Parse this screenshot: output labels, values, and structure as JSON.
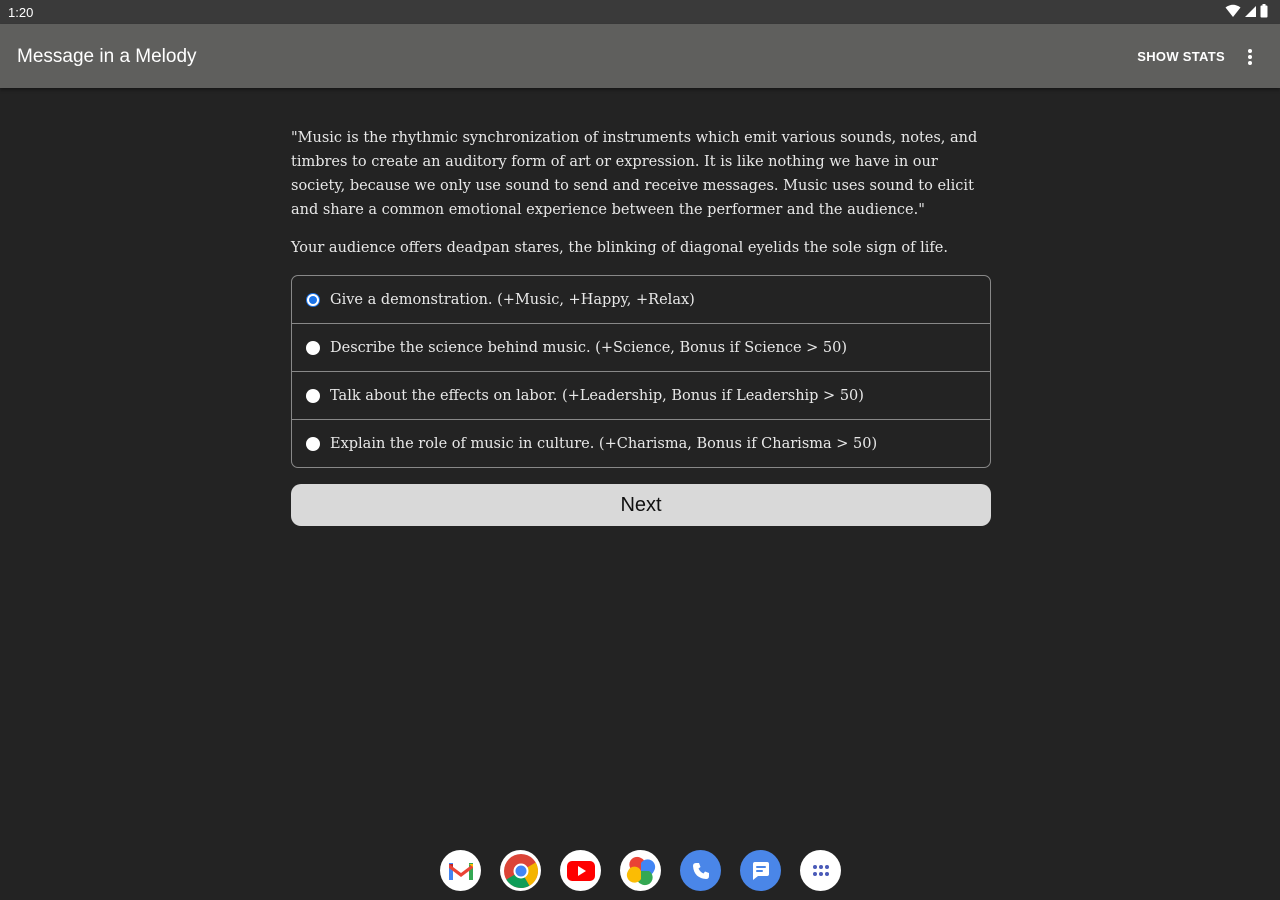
{
  "status_bar": {
    "time": "1:20",
    "icons": [
      "wifi-icon",
      "cell-signal-icon",
      "battery-icon"
    ]
  },
  "app_bar": {
    "title": "Message in a Melody",
    "show_stats_label": "SHOW STATS",
    "overflow_icon": "more-vertical-icon"
  },
  "content": {
    "quote": "\"Music is the rhythmic synchronization of instruments which emit various sounds, notes, and timbres to create an auditory form of art or expression. It is like nothing we have in our society, because we only use sound to send and receive messages. Music uses sound to elicit and share a common emotional experience between the performer and the audience.\"",
    "narration": "Your audience offers deadpan stares, the blinking of diagonal eyelids the sole sign of life.",
    "choices": [
      {
        "label": "Give a demonstration. (+Music, +Happy, +Relax)",
        "selected": true
      },
      {
        "label": "Describe the science behind music. (+Science, Bonus if Science > 50)",
        "selected": false
      },
      {
        "label": "Talk about the effects on labor. (+Leadership, Bonus if Leadership > 50)",
        "selected": false
      },
      {
        "label": "Explain the role of music in culture. (+Charisma, Bonus if Charisma > 50)",
        "selected": false
      }
    ],
    "next_label": "Next"
  },
  "dock": {
    "apps": [
      "gmail-icon",
      "chrome-icon",
      "youtube-icon",
      "photos-icon",
      "phone-icon",
      "messages-icon",
      "app-drawer-icon"
    ]
  },
  "colors": {
    "background": "#232323",
    "app_bar": "#5f5f5d",
    "status_bar": "#3a3a3a",
    "radio_accent": "#1a73e8",
    "button": "#d9d9d9"
  }
}
